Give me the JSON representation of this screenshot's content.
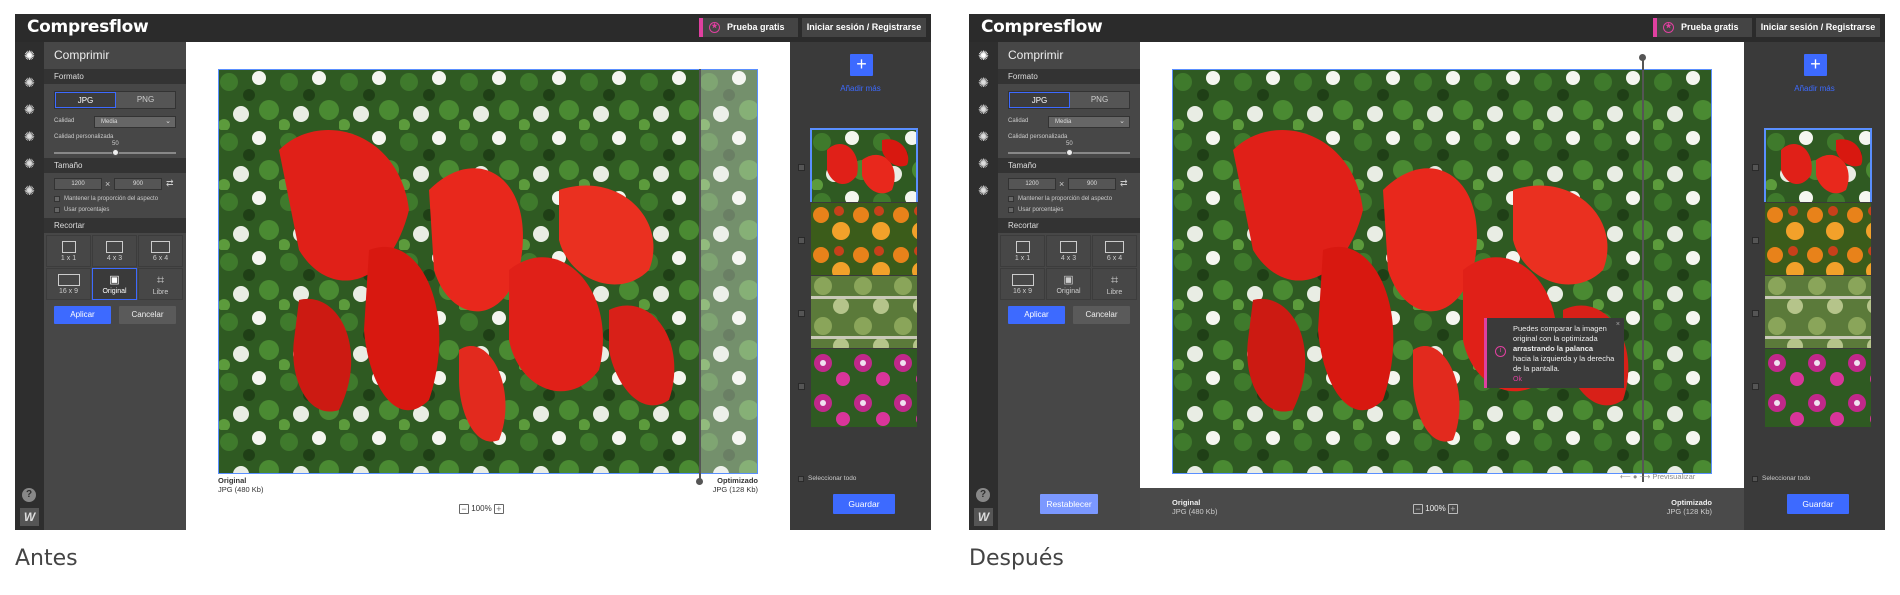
{
  "app": {
    "logo": "Compresflow",
    "trial_button": "Prueba gratis",
    "login_button": "Iniciar sesión / Registrarse"
  },
  "sidebar": {
    "title": "Comprimir",
    "format_section": "Formato",
    "format_options": [
      "JPG",
      "PNG"
    ],
    "quality_label": "Calidad",
    "quality_value": "Media",
    "custom_quality_label": "Calidad personalizada",
    "custom_quality_value": "50",
    "size_section": "Tamaño",
    "width": "1200",
    "height": "900",
    "keep_ratio_label": "Mantener la proporción del aspecto",
    "use_percent_label": "Usar porcentajes",
    "crop_section": "Recortar",
    "crop_options": [
      "1 x 1",
      "4 x 3",
      "6 x 4",
      "16 x 9",
      "Original",
      "Libre"
    ],
    "apply_button": "Aplicar",
    "cancel_button": "Cancelar"
  },
  "canvas": {
    "original_title": "Original",
    "original_meta": "JPG (480 Kb)",
    "optimized_title": "Optimizado",
    "optimized_meta": "JPG (128 Kb)",
    "zoom": "100%",
    "comparison_level_before": 0.89,
    "comparison_level_after": 0.87
  },
  "right_panel": {
    "add_more": "Añadir más",
    "select_all": "Seleccionar todo",
    "save_button": "Guardar"
  },
  "after": {
    "tooltip_line1": "Puedes comparar la imagen original con la optimizada",
    "tooltip_bold": "arrastrando la palanca",
    "tooltip_line2": "hacia la izquierda y la derecha de la pantalla.",
    "tooltip_ok": "Ok",
    "reset_button": "Restablecer",
    "preview_label": "Previsualizar"
  },
  "captions": {
    "before": "Antes",
    "after": "Después"
  },
  "colors": {
    "accent": "#3d6aff",
    "pink": "#e040a0",
    "dark": "#3c3c3c"
  },
  "icons": [
    "settings-icon",
    "help-icon",
    "w-logo-icon",
    "plus-icon",
    "info-icon",
    "arrow-left-icon",
    "arrow-right-icon",
    "image-icon",
    "crop-icon"
  ]
}
